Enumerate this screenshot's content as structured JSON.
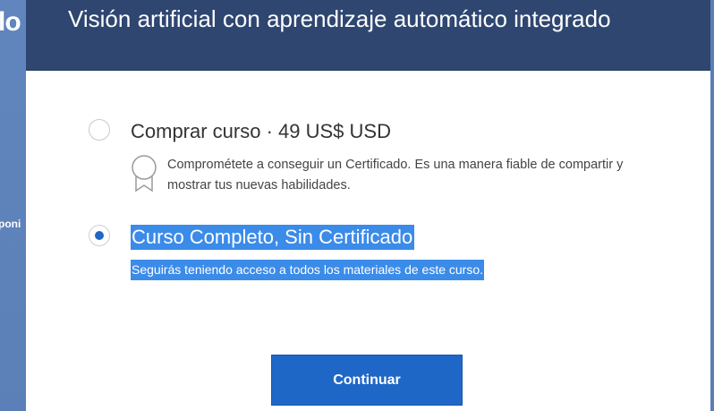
{
  "background": {
    "title_fragment": "lo",
    "text_fragment": "poni"
  },
  "modal": {
    "title": "Visión artificial con aprendizaje automático integrado",
    "options": [
      {
        "label": "Comprar curso · 49 US$ USD",
        "description": "Comprométete a conseguir un Certificado. Es una manera fiable de compartir y mostrar tus nuevas habilidades.",
        "icon": "certificate-icon",
        "selected": false
      },
      {
        "label": "Curso Completo, Sin Certificado",
        "description": "Seguirás teniendo acceso a todos los materiales de este curso.",
        "selected": true
      }
    ],
    "continue_label": "Continuar"
  },
  "colors": {
    "header_bg": "#2e4670",
    "primary_button": "#1f67c6",
    "selection_highlight": "#3b8be9",
    "page_bg": "#5a7db3"
  }
}
